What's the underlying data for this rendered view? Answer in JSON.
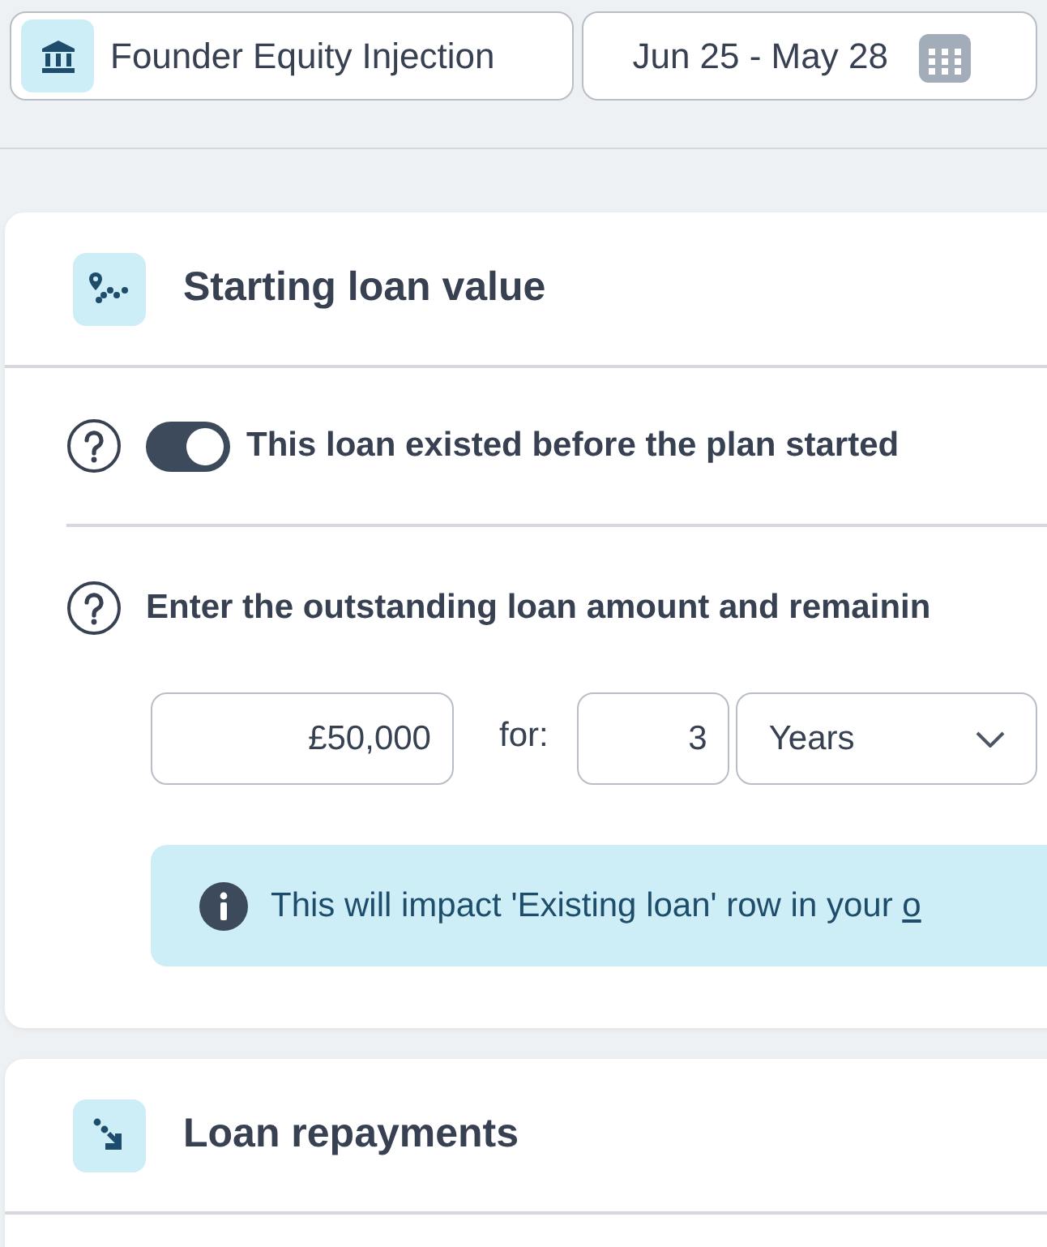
{
  "account_selector": {
    "label": "Founder Equity Injection"
  },
  "date_range": {
    "label": "Jun 25 - May 28"
  },
  "sections": [
    {
      "kind": "starting",
      "title": "Starting loan value",
      "rows": [
        {
          "kind": "toggle",
          "label": "This loan existed before the plan started",
          "on": true
        },
        {
          "kind": "amount",
          "label": "Enter the outstanding loan amount and remainin",
          "amount": "£50,000",
          "for_label": "for:",
          "term": "3",
          "term_unit": "Years",
          "info": {
            "text": "This will impact 'Existing loan' row in your",
            "link": "o"
          }
        }
      ]
    },
    {
      "kind": "repayments",
      "title": "Loan repayments"
    }
  ]
}
